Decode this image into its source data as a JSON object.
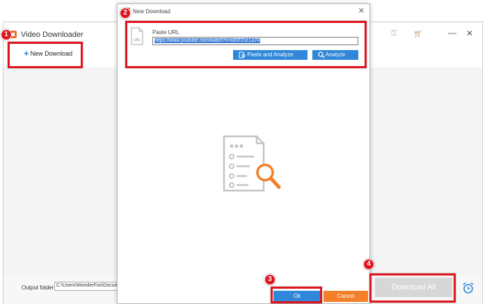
{
  "main_window": {
    "title": "Video Downloader",
    "new_download_label": "New Download",
    "output_folder_label": "Output folder:",
    "output_folder_value": "C:\\Users\\WonderFox\\Documen",
    "download_all_label": "Download All"
  },
  "dialog": {
    "title": "New Download",
    "paste_url_label": "Paste URL",
    "url_value": "https://www.youtube.com/watch?v=nlDFZvLLa74",
    "paste_analyze_label": "Paste and Analyze",
    "analyze_label": "Analyze",
    "ok_label": "Ok",
    "cancel_label": "Cancel",
    "close_glyph": "✕"
  },
  "annotations": [
    "1",
    "2",
    "3",
    "4"
  ],
  "icons": {
    "main": [
      "key-icon",
      "cart-icon",
      "minimize-icon",
      "close-icon",
      "plus-icon",
      "alarm-clock-icon"
    ],
    "dialog": [
      "app-logo-icon",
      "url-file-icon",
      "clipboard-search-icon",
      "search-icon",
      "document-search-illustration"
    ]
  },
  "colors": {
    "accent_blue": "#2e87d8",
    "cancel_orange": "#f37f28",
    "annotation_red": "#e0141e",
    "disabled_gray": "#d7d7d7"
  }
}
